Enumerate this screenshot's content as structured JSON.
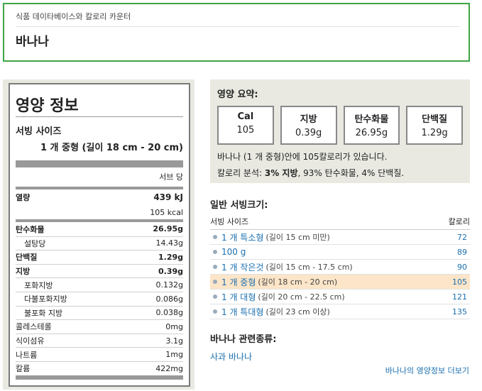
{
  "header": {
    "breadcrumb": "식품 데이타베이스와 칼로리 카운터",
    "title": "바나나"
  },
  "nutrition": {
    "title": "영양 정보",
    "serving_label": "서빙 사이즈",
    "serving_value": "1 개 중형 (길이 18 cm - 20 cm)",
    "per_serving": "서브 당",
    "energy_label": "열량",
    "energy_kj": "439 kJ",
    "energy_kcal": "105 kcal",
    "rows": [
      {
        "label": "탄수화물",
        "value": "26.95g",
        "type": "bold"
      },
      {
        "label": "설탕당",
        "value": "14.43g",
        "type": "sub"
      },
      {
        "label": "단백질",
        "value": "1.29g",
        "type": "bold"
      },
      {
        "label": "지방",
        "value": "0.39g",
        "type": "bold"
      },
      {
        "label": "포화지방",
        "value": "0.132g",
        "type": "sub"
      },
      {
        "label": "다불포화지방",
        "value": "0.086g",
        "type": "sub"
      },
      {
        "label": "불포화 지방",
        "value": "0.038g",
        "type": "sub"
      },
      {
        "label": "콜레스테롤",
        "value": "0mg",
        "type": "plain"
      },
      {
        "label": "식이섬유",
        "value": "3.1g",
        "type": "plain"
      },
      {
        "label": "나트륨",
        "value": "1mg",
        "type": "plain"
      },
      {
        "label": "칼륨",
        "value": "422mg",
        "type": "plain"
      }
    ]
  },
  "summary": {
    "title": "영양 요약:",
    "boxes": [
      {
        "name": "Cal",
        "value": "105"
      },
      {
        "name": "지방",
        "value": "0.39g"
      },
      {
        "name": "탄수화물",
        "value": "26.95g"
      },
      {
        "name": "단백질",
        "value": "1.29g"
      }
    ],
    "line1": "바나나 (1 개 중형)안에 105칼로리가 있습니다.",
    "line2_prefix": "칼로리 분석: ",
    "line2_bold": "3% 지방",
    "line2_rest": ", 93% 탄수화물, 4% 단백질."
  },
  "servings": {
    "title": "일반 서빙크기:",
    "col_size": "서빙 사이즈",
    "col_cal": "칼로리",
    "rows": [
      {
        "name": "1 개 특소형",
        "detail": "(길이 15 cm 미만)",
        "cal": "72",
        "highlight": false
      },
      {
        "name": "100 g",
        "detail": "",
        "cal": "89",
        "highlight": false
      },
      {
        "name": "1 개 작은것",
        "detail": "(길이 15 cm - 17.5 cm)",
        "cal": "90",
        "highlight": false
      },
      {
        "name": "1 개 중형",
        "detail": "(길이 18 cm - 20 cm)",
        "cal": "105",
        "highlight": true
      },
      {
        "name": "1 개 대형",
        "detail": "(길이 20 cm - 22.5 cm)",
        "cal": "121",
        "highlight": false
      },
      {
        "name": "1 개 특대형",
        "detail": "(길이 23 cm 이상)",
        "cal": "135",
        "highlight": false
      }
    ]
  },
  "related": {
    "title": "바나나 관련종류:",
    "link": "사과 바나나"
  },
  "more_link": "바나나의 영양정보 더보기"
}
